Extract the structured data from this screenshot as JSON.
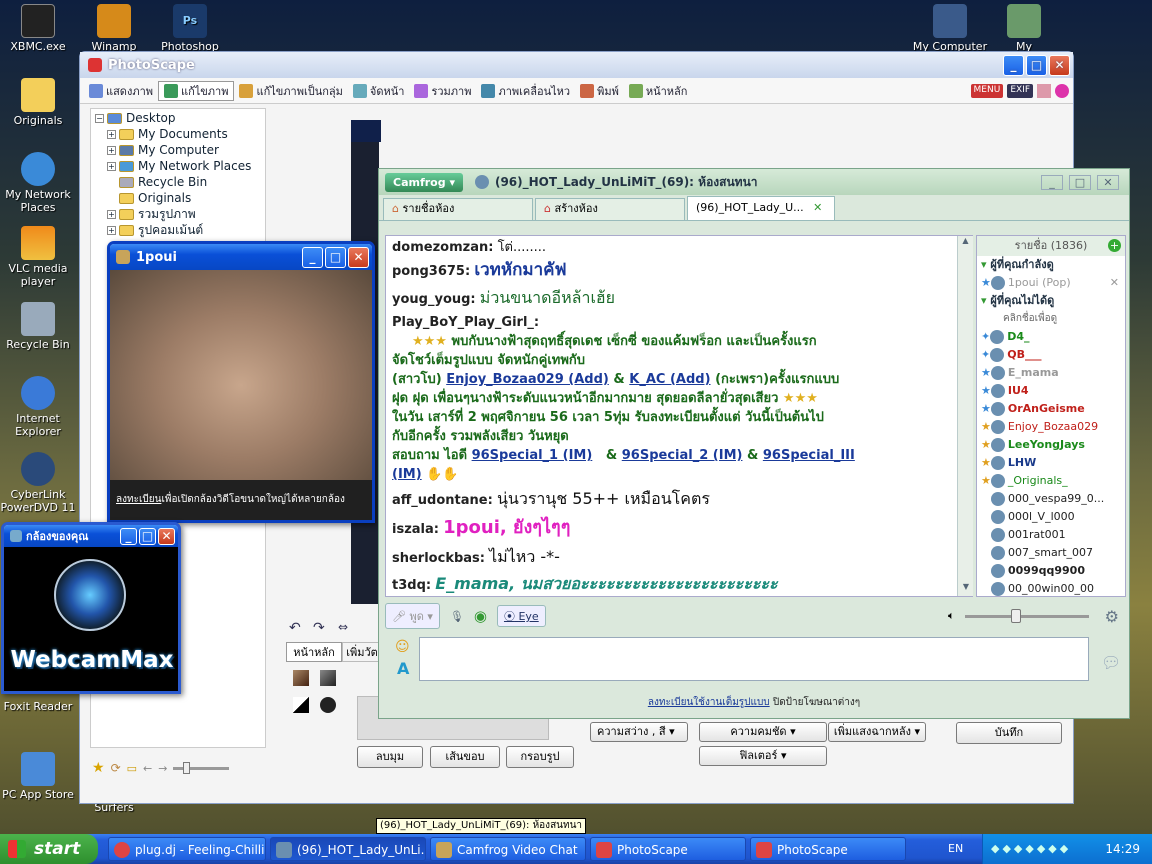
{
  "desktop_icons": {
    "xbmc": "XBMC.exe",
    "winamp": "Winamp",
    "photoshop": "Photoshop",
    "my_computer": "My Computer",
    "my_documents": "My Documents",
    "originals": "Originals",
    "network": "My Network Places",
    "vlc": "VLC media player",
    "recycle": "Recycle Bin",
    "ie": "Internet Explorer",
    "cyberlink": "CyberLink PowerDVD 11",
    "foxit": "Foxit Reader",
    "pcapp": "PC App Store",
    "subway": "Subway Surfers"
  },
  "photoscape": {
    "title": "PhotoScape",
    "tabs": [
      "แสดงภาพ",
      "แก้ไขภาพ",
      "แก้ไขภาพเป็นกลุ่ม",
      "จัดหน้า",
      "รวมภาพ",
      "ภาพเคลื่อนไหว",
      "พิมพ์",
      "หน้าหลัก"
    ],
    "menu_label": "MENU",
    "exif_label": "EXIF",
    "tree": [
      "Desktop",
      "My Documents",
      "My Computer",
      "My Network Places",
      "Recycle Bin",
      "Originals",
      "รวมรูปภาพ",
      "รูปคอมเม้นต์"
    ],
    "bottom_tabs": [
      "หน้าหลัก",
      "เพิ่มวัต"
    ],
    "buttons": {
      "round": "ลบมุม",
      "border": "เส้นขอบ",
      "frame": "กรอบรูป",
      "save": "บันทึก"
    },
    "dropdowns": {
      "brightness": "ความสว่าง , สี",
      "sharpen": "ความคมชัด",
      "backlight": "เพิ่มแสงฉากหลัง",
      "filter": "ฟิลเตอร์"
    }
  },
  "cam_window": {
    "title": "1poui",
    "caption_link": "ลงทะเบียน",
    "caption_rest": "เพื่อเปิดกล้องวิดีโอขนาดใหญ่ได้หลายกล้อง"
  },
  "webcam_window": {
    "title": "กล้องของคุณ",
    "logo": "WebcamMax"
  },
  "camfrog": {
    "menu": "Camfrog",
    "title": "(96)_HOT_Lady_UnLiMiT_(69): ห้องสนทนา",
    "tabs": [
      "รายชื่อห้อง",
      "สร้างห้อง",
      "(96)_HOT_Lady_U..."
    ],
    "chat": [
      {
        "nick": "domezomzan:",
        "text": "โต่........"
      },
      {
        "nick": "pong3675:",
        "text": "เวทหักมาคัฟ"
      },
      {
        "nick": "youg_youg:",
        "text": "ม่วนขนาดอีหล้าเฮ้ย"
      },
      {
        "nick": "Play_BoY_Play_Girl_:",
        "text": ""
      },
      {
        "nick": "aff_udontane:",
        "text": "นุ่นวรานุช  55++ เหมือนโคตร"
      },
      {
        "nick": "iszala:",
        "text": "1poui, ยังๆไๆๆ"
      },
      {
        "nick": "sherlockbas:",
        "text": "ไม่ไหว -*-"
      },
      {
        "nick": "t3dq:",
        "text": "E_mama, นมสวยอะะะะะะะะะะะะะะะะะะะะะะะ"
      }
    ],
    "announce": {
      "l1": "พบกับนางฟ้าสุดฤทธิ์สุดเดช เซ็กซี่ ของแค้มฟร็อก และเป็นครั้งแรก",
      "l2": "จัดโชว์เต็มรูปแบบ  จัดหนักคู่เทพกับ",
      "l3a": "(สาวโบ)",
      "link1": "Enjoy_Bozaa029 (Add)",
      "amp": "&",
      "link2": "K_AC (Add)",
      "l3b": "(กะเพรา)ครั้งแรกแบบ",
      "l4": "ฝุด ฝุด เพื่อนๆนางฟ้าระดับแนวหน้าอีกมากมาย สุดยอดลีลายั่วสุดเสียว",
      "l5": "ในวัน เสาร์ที่ 2 พฤศจิกายน 56  เวลา 5ทุ่ม รับลงทะเบียนตั้งแต่ วันนี้เป็นต้นไป",
      "l6": "กับอีกครั้ง รวมพลังเสียว วันหยุด",
      "l7": "สอบถาม ไอดี",
      "im1": "96Special_1 (IM)",
      "im2": "96Special_2 (IM)",
      "im3": "96Special_III",
      "im3b": "(IM)"
    },
    "users_header": "รายชื่อ (1836)",
    "groups": {
      "watching": "ผู้ที่คุณกำลังดู",
      "not_watching": "ผู้ที่คุณไม่ได้ดู",
      "click_hint": "คลิกชื่อเพื่อดู"
    },
    "users": [
      "1poui (Pop)",
      "D4_",
      "QB___",
      "E_mama",
      "IU4",
      "OrAnGeisme",
      "Enjoy_Bozaa029",
      "LeeYongJays",
      "LHW",
      "_Originals_",
      "000_vespa99_0...",
      "000l_V_l000",
      "001rat001",
      "007_smart_007",
      "0099qq9900",
      "00_00win00_00"
    ],
    "user_colors": [
      "#999999",
      "#1a8a1a",
      "#c0201a",
      "#999999",
      "#c0201a",
      "#c0201a",
      "#c0201a",
      "#1a8a1a",
      "#1a3a8a",
      "#1a8a1a",
      "#222222",
      "#222222",
      "#222222",
      "#222222",
      "#222222",
      "#222222"
    ],
    "talk": "พูด",
    "eye": "Eye",
    "footer_link": "ลงทะเบียนใช้งานเต็มรูปแบบ",
    "footer_rest": "ปิดป้ายโฆษณาต่างๆ"
  },
  "taskbar": {
    "start": "start",
    "items": [
      "plug.dj - Feeling-Chilli...",
      "(96)_HOT_Lady_UnLi...",
      "Camfrog Video Chat",
      "PhotoScape",
      "PhotoScape"
    ],
    "tooltip": "(96)_HOT_Lady_UnLiMiT_(69): ห้องสนทนา",
    "lang": "EN",
    "clock": "14:29"
  }
}
